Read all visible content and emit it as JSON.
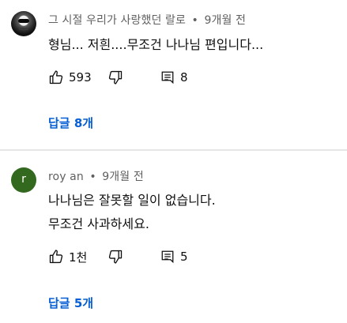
{
  "comments": [
    {
      "author": "그 시절 우리가 사랑했던 랄로",
      "separator": "•",
      "time": "9개월 전",
      "lines": [
        "형님... 저흰....무조건 나나님 편입니다..."
      ],
      "likes": "593",
      "reply_count": "8",
      "replies_link": "답글 8개",
      "avatar_icon": "masked-avatar-icon"
    },
    {
      "author": "roy an",
      "separator": "•",
      "time": "9개월 전",
      "lines": [
        "나나님은 잘못할 일이 없습니다.",
        "무조건 사과하세요."
      ],
      "likes": "1천",
      "reply_count": "5",
      "replies_link": "답글 5개",
      "avatar_letter": "r",
      "avatar_color": "#33691e"
    }
  ],
  "colors": {
    "link": "#065fd4",
    "meta": "#606060",
    "text": "#0f0f0f"
  }
}
